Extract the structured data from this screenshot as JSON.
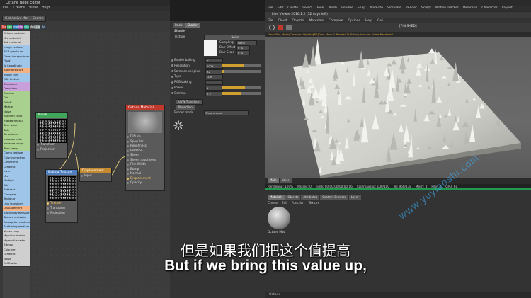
{
  "node_editor": {
    "title": "Octane Node Editor",
    "menu": [
      "File",
      "Create",
      "View",
      "Help"
    ],
    "get_active_label": "Get Active Mat",
    "search_label": "Search",
    "filters": [
      {
        "label": "Tex",
        "color": "#c0392b"
      },
      {
        "label": "Gen",
        "color": "#27ae60"
      },
      {
        "label": "Img",
        "color": "#2980b9"
      },
      {
        "label": "Map",
        "color": "#8e44ad"
      },
      {
        "label": "Oth",
        "color": "#16a085"
      },
      {
        "label": "Med",
        "color": "#555555"
      },
      {
        "label": "Lib",
        "color": "#7f8c8d"
      },
      {
        "label": "All",
        "color": "#2c3e50"
      }
    ],
    "node_list": [
      {
        "label": "Octane material",
        "color": "#cfcfcf"
      },
      {
        "label": "Mix material",
        "color": "#cfcfcf"
      },
      {
        "label": "Sub material",
        "color": "#cfcfcf"
      },
      {
        "label": "Image texture",
        "color": "#9fc5e8"
      },
      {
        "label": "RGB spectrum",
        "color": "#9fc5e8"
      },
      {
        "label": "Gaussian spectrum",
        "color": "#9fc5e8"
      },
      {
        "label": "Float",
        "color": "#9fc5e8"
      },
      {
        "label": "W Coordinate",
        "color": "#9fc5e8"
      },
      {
        "label": "Baking texture",
        "color": "#f4b183"
      },
      {
        "label": "Image tiles",
        "color": "#9fc5e8"
      },
      {
        "label": "OSL texture",
        "color": "#9fc5e8"
      },
      {
        "label": "Transform",
        "color": "#c9a0dc"
      },
      {
        "label": "Projection",
        "color": "#c9a0dc"
      },
      {
        "label": "Checker",
        "color": "#a9d08e"
      },
      {
        "label": "Dirt",
        "color": "#a9d08e"
      },
      {
        "label": "Falloff",
        "color": "#a9d08e"
      },
      {
        "label": "Marble",
        "color": "#a9d08e"
      },
      {
        "label": "Noise",
        "color": "#a9d08e"
      },
      {
        "label": "Random color",
        "color": "#a9d08e"
      },
      {
        "label": "Ridged fractal",
        "color": "#a9d08e"
      },
      {
        "label": "Sine wave",
        "color": "#a9d08e"
      },
      {
        "label": "Side",
        "color": "#a9d08e"
      },
      {
        "label": "Turbulence",
        "color": "#a9d08e"
      },
      {
        "label": "Instance color",
        "color": "#a9d08e"
      },
      {
        "label": "Instance range",
        "color": "#a9d08e"
      },
      {
        "label": "Toon ramp",
        "color": "#a9d08e"
      },
      {
        "label": "Clamp texture",
        "color": "#9fc5e8"
      },
      {
        "label": "Color correction",
        "color": "#9fc5e8"
      },
      {
        "label": "Cosine mix",
        "color": "#9fc5e8"
      },
      {
        "label": "Gradient",
        "color": "#9fc5e8"
      },
      {
        "label": "Invert",
        "color": "#9fc5e8"
      },
      {
        "label": "Mix",
        "color": "#9fc5e8"
      },
      {
        "label": "Multiply",
        "color": "#9fc5e8"
      },
      {
        "label": "Add",
        "color": "#9fc5e8"
      },
      {
        "label": "Subtract",
        "color": "#9fc5e8"
      },
      {
        "label": "Compare",
        "color": "#9fc5e8"
      },
      {
        "label": "Triplanar",
        "color": "#9fc5e8"
      },
      {
        "label": "Uvw transform",
        "color": "#9fc5e8"
      },
      {
        "label": "Displacement",
        "color": "#f4b183"
      },
      {
        "label": "Blackbody emission",
        "color": "#9fc5e8"
      },
      {
        "label": "Texture emission",
        "color": "#9fc5e8"
      },
      {
        "label": "Absorption medium",
        "color": "#9fc5e8"
      },
      {
        "label": "Scattering medium",
        "color": "#9fc5e8"
      },
      {
        "label": "Vertex map",
        "color": "#cfcfcf"
      },
      {
        "label": "Mg color shader",
        "color": "#cfcfcf"
      },
      {
        "label": "Mg multi shader",
        "color": "#cfcfcf"
      },
      {
        "label": "Bitmap",
        "color": "#cfcfcf"
      },
      {
        "label": "Colorizer",
        "color": "#cfcfcf"
      },
      {
        "label": "Gradient",
        "color": "#cfcfcf"
      },
      {
        "label": "Noise",
        "color": "#cfcfcf"
      },
      {
        "label": "RefShader",
        "color": "#cfcfcf"
      }
    ],
    "nodes": {
      "noise": {
        "title": "Noise",
        "color": "#3fa65a",
        "inputs": [
          "Transform",
          "Projection"
        ]
      },
      "baking": {
        "title": "Baking Texture",
        "color": "#4f7fc0",
        "inputs": [
          "Texture",
          "Transform",
          "Projection"
        ]
      },
      "displacement": {
        "title": "Displacement",
        "color": "#c48a30",
        "inputs": [
          "Input"
        ]
      },
      "material": {
        "title": "Octane Material",
        "color": "#c0392b",
        "inputs": [
          "Diffuse",
          "Specular",
          "Roughness",
          "Rotation",
          "Sheen",
          "Sheen roughness",
          "Film Width",
          "Bump",
          "Normal",
          "Displacement",
          "Opacity"
        ]
      }
    }
  },
  "attributes": {
    "tabs": [
      "Basic",
      "Shader"
    ],
    "section": "Shader",
    "texture_label": "Texture",
    "texture_button": "Noise",
    "sampling_label": "Sampling",
    "sampling_value": "None",
    "blur_offset_label": "Blur Offset",
    "blur_offset_value": "0 %",
    "blur_scale_label": "Blur Scale",
    "blur_scale_value": "0 %",
    "rows": [
      {
        "label": "Enable baking",
        "value": "✓",
        "fill": 0
      },
      {
        "label": "Resolution",
        "value": "1024",
        "fill": 0.55
      },
      {
        "label": "Samples per pixel",
        "value": "32",
        "fill": 0.03
      },
      {
        "label": "Type",
        "value": "LDR",
        "fill": 0
      },
      {
        "label": "RGB baking",
        "value": "",
        "fill": 0
      },
      {
        "label": "Power",
        "value": "1",
        "fill": 0.6
      },
      {
        "label": "Gamma",
        "value": "2.2",
        "fill": 0.5
      }
    ],
    "uvw_button": "UVW Transform",
    "projection_button": "Projection",
    "border_mode_label": "Border mode",
    "border_mode_value": "Wrap around"
  },
  "viewer": {
    "app_menu": [
      "File",
      "Edit",
      "Create",
      "Select",
      "Tools",
      "Mesh",
      "Volume",
      "Snap",
      "Animate",
      "Simulate",
      "Render",
      "Sculpt",
      "Motion Tracker",
      "MoGraph",
      "Character",
      "Layout"
    ],
    "title": "Live Viewer 2016.1.2 (32 days left)",
    "menu": [
      "File",
      "Cloud",
      "Objects",
      "Materials",
      "Compare",
      "Options",
      "Help",
      "Gui"
    ],
    "finished": "[FINISHED]",
    "path": "Dme:Files-Mesh(Core(ver: Update[80]Dex; Mesh 1 Render 2) Baking texture; Noise:Rendered",
    "status": [
      "Rendering: 100%",
      "Ms/sec: 0",
      "Time: 00:00:00/00:00:16",
      "Spp/maxspp: 100/100",
      "Tri: 960/138",
      "Mesh: 4",
      "Hair: 0",
      "GPU: 61"
    ],
    "main_tab": "Main",
    "noise_tab": "Noise"
  },
  "material_manager": {
    "tabs": [
      "Materials",
      "Objects",
      "Attributes",
      "Content Browser",
      "Layer"
    ],
    "menu": [
      "Create",
      "Edit",
      "Function",
      "Texture"
    ],
    "material_name": "Octane Mat",
    "bottom": "Octane"
  },
  "subtitles": {
    "chinese": "但是如果我们把这个值提高",
    "english": "But if we bring this value up,"
  },
  "watermark": "www.yuyiaoshi.com"
}
